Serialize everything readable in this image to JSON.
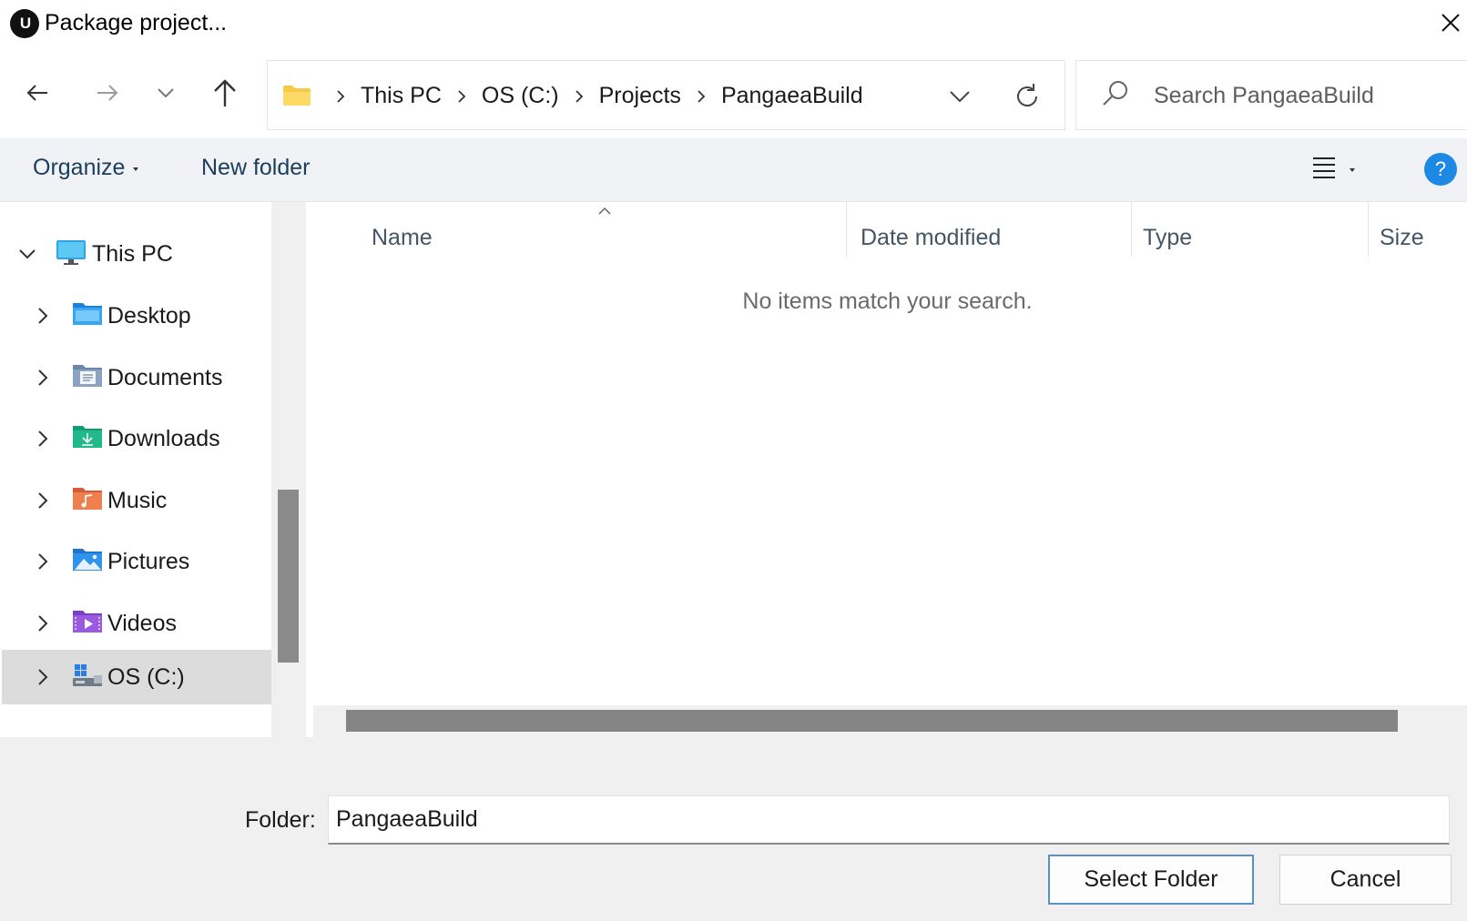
{
  "window": {
    "title": "Package project...",
    "logo_text": "U"
  },
  "nav": {
    "breadcrumbs": [
      "This PC",
      "OS (C:)",
      "Projects",
      "PangaeaBuild"
    ],
    "search_placeholder": "Search PangaeaBuild"
  },
  "toolbar": {
    "organize_label": "Organize",
    "new_folder_label": "New folder",
    "help_label": "?"
  },
  "sidebar": {
    "items": [
      {
        "label": "This PC",
        "icon": "monitor-icon",
        "expanded": true
      },
      {
        "label": "Desktop",
        "icon": "desktop-folder-icon"
      },
      {
        "label": "Documents",
        "icon": "documents-folder-icon"
      },
      {
        "label": "Downloads",
        "icon": "downloads-folder-icon"
      },
      {
        "label": "Music",
        "icon": "music-folder-icon"
      },
      {
        "label": "Pictures",
        "icon": "pictures-folder-icon"
      },
      {
        "label": "Videos",
        "icon": "videos-folder-icon"
      },
      {
        "label": "OS (C:)",
        "icon": "drive-icon",
        "selected": true
      }
    ]
  },
  "list": {
    "columns": [
      "Name",
      "Date modified",
      "Type",
      "Size"
    ],
    "empty_message": "No items match your search."
  },
  "footer": {
    "folder_label": "Folder:",
    "folder_value": "PangaeaBuild",
    "select_button": "Select Folder",
    "cancel_button": "Cancel"
  },
  "colors": {
    "accent": "#1e88e5",
    "link_text": "#1b3d5e",
    "primary_button_border": "#5a8fc9",
    "selected_item_bg": "#dcdcdc"
  }
}
